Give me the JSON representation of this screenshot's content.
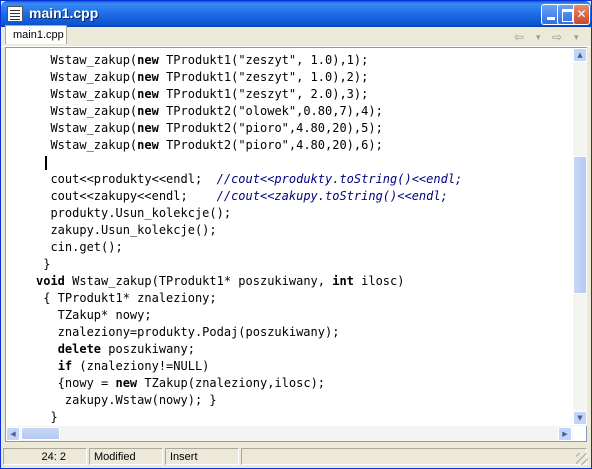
{
  "window": {
    "title": "main1.cpp",
    "minimize_glyph": "",
    "maximize_glyph": "",
    "close_glyph": "✕"
  },
  "tabs": [
    {
      "label": "main1.cpp"
    }
  ],
  "nav": {
    "back_glyph": "⇦",
    "back_dropdown_glyph": "▾",
    "forward_glyph": "⇨",
    "forward_dropdown_glyph": "▾"
  },
  "editor": {
    "lines": [
      [
        {
          "t": "  Wstaw_zakup(",
          "c": ""
        },
        {
          "t": "new",
          "c": "kw"
        },
        {
          "t": " TProdukt1(\"zeszyt\", 1.0),1);",
          "c": ""
        }
      ],
      [
        {
          "t": "  Wstaw_zakup(",
          "c": ""
        },
        {
          "t": "new",
          "c": "kw"
        },
        {
          "t": " TProdukt1(\"zeszyt\", 1.0),2);",
          "c": ""
        }
      ],
      [
        {
          "t": "  Wstaw_zakup(",
          "c": ""
        },
        {
          "t": "new",
          "c": "kw"
        },
        {
          "t": " TProdukt1(\"zeszyt\", 2.0),3);",
          "c": ""
        }
      ],
      [
        {
          "t": "  Wstaw_zakup(",
          "c": ""
        },
        {
          "t": "new",
          "c": "kw"
        },
        {
          "t": " TProdukt2(\"olowek\",0.80,7),4);",
          "c": ""
        }
      ],
      [
        {
          "t": "  Wstaw_zakup(",
          "c": ""
        },
        {
          "t": "new",
          "c": "kw"
        },
        {
          "t": " TProdukt2(\"pioro\",4.80,20),5);",
          "c": ""
        }
      ],
      [
        {
          "t": "  Wstaw_zakup(",
          "c": ""
        },
        {
          "t": "new",
          "c": "kw"
        },
        {
          "t": " TProdukt2(\"pioro\",4.80,20),6);",
          "c": ""
        }
      ],
      [
        {
          "t": "",
          "c": "caret"
        }
      ],
      [
        {
          "t": "  cout<<produkty<<endl;  ",
          "c": ""
        },
        {
          "t": "//cout<<produkty.toString()<<endl;",
          "c": "cmt"
        }
      ],
      [
        {
          "t": "  cout<<zakupy<<endl;    ",
          "c": ""
        },
        {
          "t": "//cout<<zakupy.toString()<<endl;",
          "c": "cmt"
        }
      ],
      [
        {
          "t": "  produkty.Usun_kolekcje();",
          "c": ""
        }
      ],
      [
        {
          "t": "  zakupy.Usun_kolekcje();",
          "c": ""
        }
      ],
      [
        {
          "t": "  cin.get();",
          "c": ""
        }
      ],
      [
        {
          "t": " }",
          "c": ""
        }
      ],
      [
        {
          "t": "void",
          "c": "kw"
        },
        {
          "t": " Wstaw_zakup(TProdukt1* poszukiwany, ",
          "c": ""
        },
        {
          "t": "int",
          "c": "kw"
        },
        {
          "t": " ilosc)",
          "c": ""
        }
      ],
      [
        {
          "t": " { TProdukt1* znaleziony;",
          "c": ""
        }
      ],
      [
        {
          "t": "   TZakup* nowy;",
          "c": ""
        }
      ],
      [
        {
          "t": "   znaleziony=produkty.Podaj(poszukiwany);",
          "c": ""
        }
      ],
      [
        {
          "t": "   ",
          "c": ""
        },
        {
          "t": "delete",
          "c": "kw"
        },
        {
          "t": " poszukiwany;",
          "c": ""
        }
      ],
      [
        {
          "t": "   ",
          "c": ""
        },
        {
          "t": "if",
          "c": "kw"
        },
        {
          "t": " (znaleziony!=NULL)",
          "c": ""
        }
      ],
      [
        {
          "t": "   {nowy = ",
          "c": ""
        },
        {
          "t": "new",
          "c": "kw"
        },
        {
          "t": " TZakup(znaleziony,ilosc);",
          "c": ""
        }
      ],
      [
        {
          "t": "    zakupy.Wstaw(nowy); }",
          "c": ""
        }
      ],
      [
        {
          "t": "  }",
          "c": ""
        }
      ]
    ]
  },
  "scroll": {
    "vertical_position": 0.35,
    "horizontal_position": 0.0
  },
  "status": {
    "cursor": "24:  2",
    "modified": "Modified",
    "mode": "Insert"
  },
  "colors": {
    "titlebar": "#0a55d0",
    "comment": "#000080"
  }
}
